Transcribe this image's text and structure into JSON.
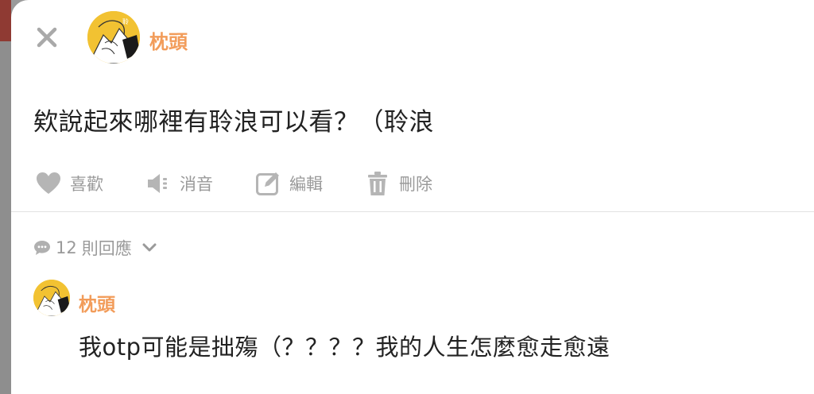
{
  "post": {
    "author": "枕頭",
    "text": "欸說起來哪裡有聆浪可以看？（聆浪"
  },
  "actions": {
    "like": "喜歡",
    "mute": "消音",
    "edit": "編輯",
    "delete": "刪除"
  },
  "replies": {
    "count": "12",
    "label": "則回應"
  },
  "comment": {
    "author": "枕頭",
    "text": "我otp可能是拙殤（？？？？我的人生怎麼愈走愈遠"
  },
  "colors": {
    "accent": "#f29c5a",
    "muted": "#9a9a9a",
    "text": "#222222",
    "avatar_bg": "#f2c232"
  },
  "icons": [
    "close-icon",
    "heart-icon",
    "speaker-mute-icon",
    "edit-icon",
    "trash-icon",
    "speech-bubble-icon",
    "chevron-down-icon"
  ]
}
